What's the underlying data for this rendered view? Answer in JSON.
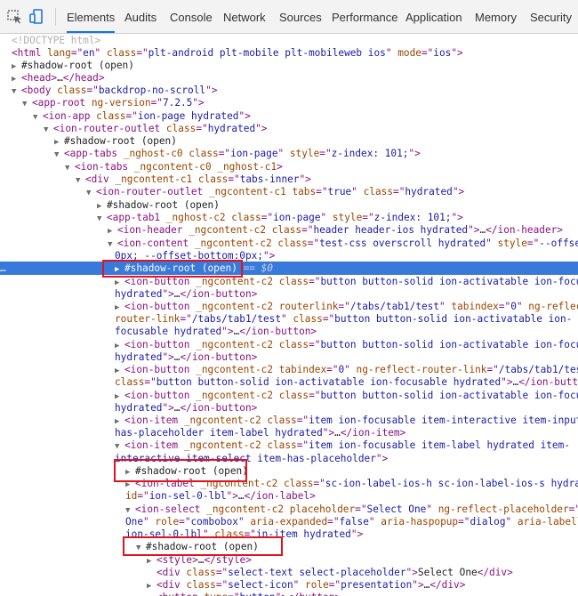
{
  "toolbar": {
    "tabs": [
      "Elements",
      "Audits",
      "Console",
      "Network",
      "Sources",
      "Performance",
      "Application",
      "Memory",
      "Security"
    ],
    "active_tab": "Elements",
    "accent_color": "#1a73e8"
  },
  "tree": {
    "doctype": "<!DOCTYPE html>",
    "selected_suffix": "== $0",
    "gutter_dots": "…"
  },
  "highlight_color": "#e0141e",
  "selection_color": "#3879d9"
}
